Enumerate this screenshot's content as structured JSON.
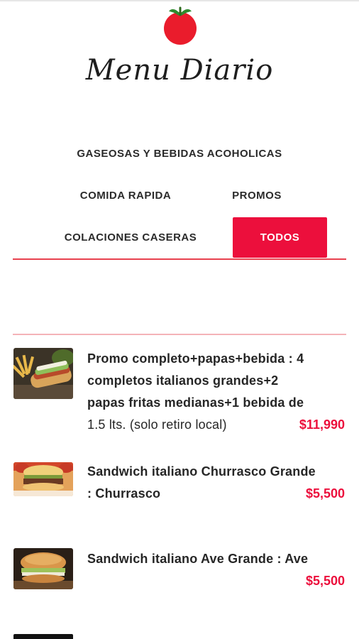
{
  "header": {
    "brand_name": "Menu Diario",
    "logo_icon": "tomato-icon"
  },
  "categories": [
    {
      "label": "GASEOSAS Y BEBIDAS ACOHOLICAS",
      "active": false
    },
    {
      "label": "COMIDA RAPIDA",
      "active": false
    },
    {
      "label": "PROMOS",
      "active": false
    },
    {
      "label": "COLACIONES CASERAS",
      "active": false
    },
    {
      "label": "TODOS",
      "active": true
    }
  ],
  "products": [
    {
      "lines": [
        "Promo completo+papas+bebida : 4",
        "completos italianos grandes+2",
        "papas fritas medianas+1 bebida de",
        "1.5 lts. (solo retiro local)"
      ],
      "price": "$11,990"
    },
    {
      "lines": [
        "Sandwich italiano Churrasco Grande",
        ": Churrasco"
      ],
      "price": "$5,500"
    },
    {
      "lines": [
        "Sandwich italiano Ave Grande : Ave"
      ],
      "price": "$5,500"
    }
  ],
  "colors": {
    "accent": "#ec0f3c",
    "divider": "#e8414f",
    "text": "#262626"
  }
}
